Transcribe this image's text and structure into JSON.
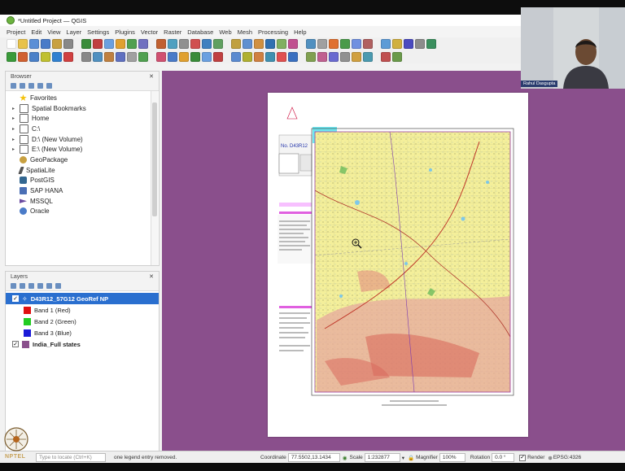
{
  "app": {
    "title": "*Untitled Project — QGIS",
    "menus": [
      "Project",
      "Edit",
      "View",
      "Layer",
      "Settings",
      "Plugins",
      "Vector",
      "Raster",
      "Database",
      "Web",
      "Mesh",
      "Processing",
      "Help"
    ]
  },
  "browser": {
    "title": "Browser",
    "items": [
      {
        "label": "Favorites",
        "icon": "star-icon"
      },
      {
        "label": "Spatial Bookmarks",
        "icon": "bookmark-icon"
      },
      {
        "label": "Home",
        "icon": "home-folder-icon"
      },
      {
        "label": "C:\\",
        "icon": "drive-icon"
      },
      {
        "label": "D:\\ (New Volume)",
        "icon": "drive-icon"
      },
      {
        "label": "E:\\ (New Volume)",
        "icon": "drive-icon"
      },
      {
        "label": "GeoPackage",
        "icon": "geopackage-icon"
      },
      {
        "label": "SpatiaLite",
        "icon": "spatialite-icon"
      },
      {
        "label": "PostGIS",
        "icon": "postgis-icon"
      },
      {
        "label": "SAP HANA",
        "icon": "sap-hana-icon"
      },
      {
        "label": "MSSQL",
        "icon": "mssql-icon"
      },
      {
        "label": "Oracle",
        "icon": "oracle-icon"
      }
    ]
  },
  "layers": {
    "title": "Layers",
    "raster_layer": "D43R12_57G12 GeoRef NP",
    "bands": [
      {
        "label": "Band 1 (Red)",
        "color": "#e01010"
      },
      {
        "label": "Band 2 (Green)",
        "color": "#22cc22"
      },
      {
        "label": "Band 3 (Blue)",
        "color": "#1a1ad8"
      }
    ],
    "vector_layer": "India_Full states",
    "vector_color": "#8a4f8c"
  },
  "map": {
    "sheet_no": "No. D43R12",
    "canvas_color": "#8a4f8c"
  },
  "status": {
    "locator_placeholder": "Type to locate (Ctrl+K)",
    "message": "one legend entry removed.",
    "coordinate_label": "Coordinate",
    "coordinate_value": "77.5502,13.1434",
    "scale_label": "Scale",
    "scale_value": "1:232877",
    "magnifier_label": "Magnifier",
    "magnifier_value": "100%",
    "rotation_label": "Rotation",
    "rotation_value": "0.0 °",
    "render_label": "Render",
    "crs_label": "EPSG:4326"
  },
  "webcam": {
    "name_tag": "Rahul Dasgupta"
  },
  "branding": {
    "logo_text": "NPTEL"
  }
}
